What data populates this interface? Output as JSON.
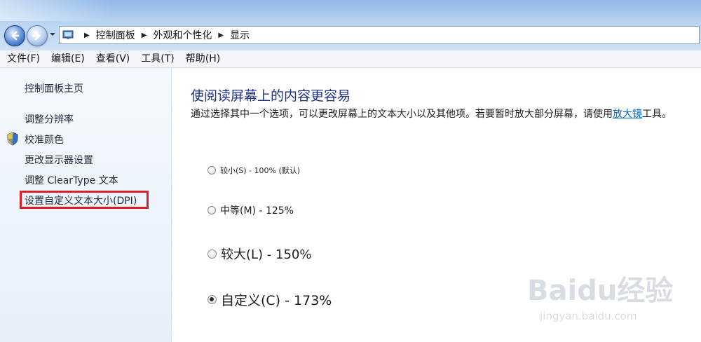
{
  "address": {
    "crumbs": [
      "控制面板",
      "外观和个性化",
      "显示"
    ]
  },
  "menu": [
    "文件(F)",
    "编辑(E)",
    "查看(V)",
    "工具(T)",
    "帮助(H)"
  ],
  "sidebar": {
    "home": "控制面板主页",
    "items": [
      {
        "label": "调整分辨率"
      },
      {
        "label": "校准颜色",
        "icon": "uac-shield-icon"
      },
      {
        "label": "更改显示器设置"
      },
      {
        "label": "调整 ClearType 文本"
      },
      {
        "label": "设置自定义文本大小(DPI)",
        "highlighted": true
      }
    ]
  },
  "main": {
    "title": "使阅读屏幕上的内容更容易",
    "desc_before": "通过选择其中一个选项，可以更改屏幕上的文本大小以及其他项。若要暂时放大部分屏幕，请使用",
    "desc_link": "放大镜",
    "desc_after": "工具。",
    "options": [
      {
        "label": "较小(S) - 100% (默认)",
        "checked": false
      },
      {
        "label": "中等(M) - 125%",
        "checked": false
      },
      {
        "label": "较大(L) - 150%",
        "checked": false
      },
      {
        "label": "自定义(C) - 173%",
        "checked": true
      }
    ]
  },
  "watermark": {
    "logo": "Baidu经验",
    "url": "jingyan.baidu.com"
  },
  "colors": {
    "title": "#1e3287",
    "link": "#0066cc",
    "highlight": "#d9202a"
  }
}
